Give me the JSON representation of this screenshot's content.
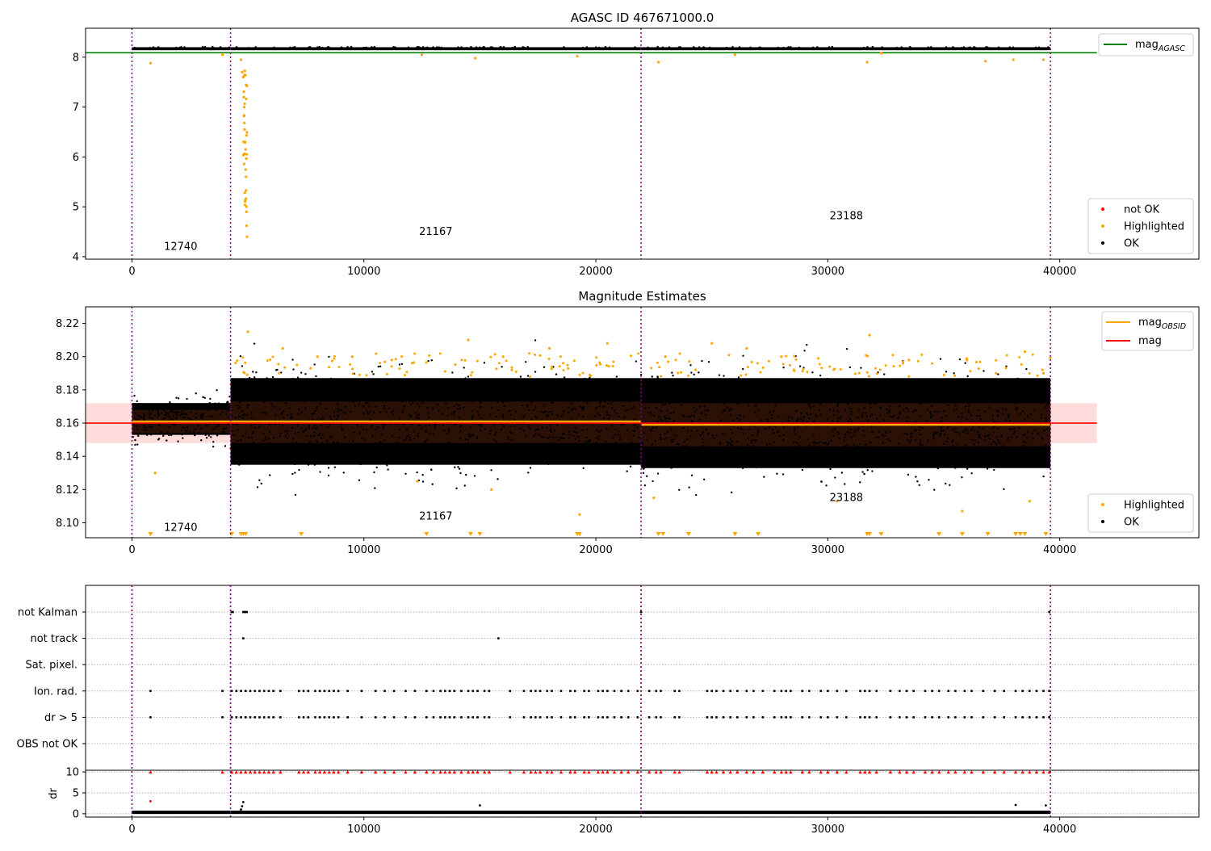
{
  "chart_data": [
    {
      "type": "scatter",
      "title": "AGASC ID 467671000.0",
      "xlim": [
        -2000,
        46000
      ],
      "ylim": [
        3.95,
        8.58
      ],
      "xticks": [
        "0",
        "10000",
        "20000",
        "30000",
        "40000"
      ],
      "yticks": [
        "4",
        "5",
        "6",
        "7",
        "8"
      ],
      "obs_boundaries": [
        0,
        4250,
        21950,
        39600
      ],
      "obsids": [
        {
          "label": "12740",
          "x": 2100,
          "y": 4.2
        },
        {
          "label": "21167",
          "x": 13100,
          "y": 4.5
        },
        {
          "label": "23188",
          "x": 30800,
          "y": 4.82
        }
      ],
      "reference_line": {
        "name": "mag$_{AGASC}$",
        "name_main": "mag",
        "name_sub": "AGASC",
        "y": 8.09,
        "x_end": 41600,
        "color": "#008000"
      },
      "ok_band": {
        "y_min": 8.14,
        "y_max": 8.2,
        "x": [
          0,
          39600
        ],
        "color": "#000000"
      },
      "highlighted": {
        "color": "#ffa500",
        "x": [
          800,
          3900,
          4700,
          4750,
          4800,
          4820,
          4840,
          4860,
          4880,
          4900,
          4920,
          4940,
          4960,
          12500,
          14800,
          19200,
          22700,
          26000,
          31700,
          32300,
          36800,
          38000,
          39300
        ],
        "y": [
          7.88,
          8.05,
          7.95,
          7.7,
          7.6,
          7.2,
          7.0,
          6.55,
          6.3,
          6.15,
          5.6,
          4.9,
          4.4,
          8.05,
          7.98,
          8.02,
          7.9,
          8.05,
          7.9,
          8.08,
          7.92,
          7.95,
          7.95
        ]
      },
      "legend_series": [
        {
          "label": "not OK",
          "color": "#ff0000"
        },
        {
          "label": "Highlighted",
          "color": "#ffa500"
        },
        {
          "label": "OK",
          "color": "#000000"
        }
      ]
    },
    {
      "type": "scatter",
      "title": "Magnitude Estimates",
      "xlim": [
        -2000,
        46000
      ],
      "ylim": [
        8.091,
        8.23
      ],
      "xticks": [
        "0",
        "10000",
        "20000",
        "30000",
        "40000"
      ],
      "yticks": [
        "8.10",
        "8.12",
        "8.14",
        "8.16",
        "8.18",
        "8.20",
        "8.22"
      ],
      "obs_boundaries": [
        0,
        4250,
        21950,
        39600
      ],
      "obsids": [
        {
          "label": "12740",
          "x": 2100,
          "y": 8.097
        },
        {
          "label": "21167",
          "x": 13100,
          "y": 8.104
        },
        {
          "label": "23188",
          "x": 30800,
          "y": 8.115
        }
      ],
      "segments": [
        {
          "x0": 0,
          "x1": 4250,
          "ok_min": 8.15,
          "ok_max": 8.175,
          "core_min": 8.154,
          "core_max": 8.168,
          "mag_obsid": 8.161
        },
        {
          "x0": 4250,
          "x1": 21950,
          "ok_min": 8.132,
          "ok_max": 8.19,
          "core_min": 8.148,
          "core_max": 8.173,
          "mag_obsid": 8.161
        },
        {
          "x0": 21950,
          "x1": 39600,
          "ok_min": 8.13,
          "ok_max": 8.19,
          "core_min": 8.146,
          "core_max": 8.172,
          "mag_obsid": 8.159
        }
      ],
      "mag_line": {
        "y": 8.16,
        "band": [
          8.148,
          8.172
        ],
        "x_end": 41600,
        "color": "#ff0000"
      },
      "highlighted": {
        "color": "#ffa500",
        "x": [
          5000,
          6500,
          8000,
          9500,
          11200,
          14500,
          16000,
          18000,
          20500,
          23000,
          25000,
          26500,
          28000,
          31800,
          33500,
          36000,
          38500,
          39300,
          1000,
          12300,
          15500,
          19300,
          22500,
          30400,
          35800,
          38700
        ],
        "y": [
          8.215,
          8.205,
          8.2,
          8.2,
          8.198,
          8.21,
          8.2,
          8.205,
          8.208,
          8.2,
          8.208,
          8.205,
          8.2,
          8.213,
          8.198,
          8.198,
          8.203,
          8.19,
          8.13,
          8.125,
          8.12,
          8.105,
          8.115,
          8.113,
          8.107,
          8.113
        ]
      },
      "below_range": {
        "color": "#ffa500",
        "x": [
          800,
          4300,
          4700,
          4800,
          4900,
          7300,
          12700,
          14600,
          15000,
          19200,
          19300,
          22700,
          22900,
          24000,
          26000,
          27000,
          31700,
          31800,
          32300,
          34800,
          35800,
          36900,
          38100,
          38300,
          38500,
          39400
        ]
      },
      "legend_lines": [
        {
          "label": "mag$_{OBSID}$",
          "label_main": "mag",
          "label_sub": "OBSID",
          "color": "#ffa500"
        },
        {
          "label": "mag",
          "label_main": "mag",
          "label_sub": "",
          "color": "#ff0000"
        }
      ],
      "legend_series": [
        {
          "label": "Highlighted",
          "color": "#ffa500"
        },
        {
          "label": "OK",
          "color": "#000000"
        }
      ]
    },
    {
      "type": "scatter",
      "title": "",
      "xlim": [
        -2000,
        46000
      ],
      "xticks": [
        "0",
        "10000",
        "20000",
        "30000",
        "40000"
      ],
      "obs_boundaries": [
        0,
        4250,
        21950,
        39600
      ],
      "flag_rows": [
        "not Kalman",
        "not track",
        "Sat. pixel.",
        "Ion. rad.",
        "dr > 5",
        "OBS not OK"
      ],
      "flags": {
        "not Kalman": [
          4300,
          4350,
          4800,
          4850,
          4900,
          4950,
          21950,
          39550
        ],
        "not track": [
          4800,
          15800
        ],
        "Ion. rad.": [
          800,
          3900,
          4300,
          4500,
          4700,
          4900,
          5100,
          5300,
          5500,
          5700,
          5900,
          6100,
          6400,
          7200,
          7400,
          7600,
          7900,
          8100,
          8300,
          8500,
          8700,
          8900,
          9300,
          9900,
          10500,
          10900,
          11300,
          11800,
          12200,
          12700,
          13000,
          13300,
          13500,
          13700,
          13900,
          14200,
          14500,
          14700,
          14900,
          15200,
          15400,
          16300,
          16900,
          17200,
          17400,
          17600,
          17900,
          18100,
          18500,
          18900,
          19100,
          19500,
          19700,
          20100,
          20300,
          20500,
          20800,
          21100,
          21400,
          21800,
          22300,
          22600,
          22800,
          23400,
          23600,
          24800,
          25000,
          25200,
          25500,
          25800,
          26100,
          26500,
          26800,
          27200,
          27700,
          28000,
          28200,
          28400,
          28900,
          29200,
          29700,
          30000,
          30400,
          30800,
          31400,
          31600,
          31800,
          32100,
          32700,
          33100,
          33400,
          33700,
          34200,
          34500,
          34800,
          35200,
          35500,
          35900,
          36200,
          36700,
          37200,
          37600,
          38100,
          38400,
          38700,
          39000,
          39300,
          39550
        ],
        "dr > 5": [
          800,
          3900,
          4300,
          4500,
          4700,
          4900,
          5100,
          5300,
          5500,
          5700,
          5900,
          6100,
          6400,
          7200,
          7400,
          7600,
          7900,
          8100,
          8300,
          8500,
          8700,
          8900,
          9300,
          9900,
          10500,
          10900,
          11300,
          11800,
          12200,
          12700,
          13000,
          13300,
          13500,
          13700,
          13900,
          14200,
          14500,
          14700,
          14900,
          15200,
          15400,
          16300,
          16900,
          17200,
          17400,
          17600,
          17900,
          18100,
          18500,
          18900,
          19100,
          19500,
          19700,
          20100,
          20300,
          20500,
          20800,
          21100,
          21400,
          21800,
          22300,
          22600,
          22800,
          23400,
          23600,
          24800,
          25000,
          25200,
          25500,
          25800,
          26100,
          26500,
          26800,
          27200,
          27700,
          28000,
          28200,
          28400,
          28900,
          29200,
          29700,
          30000,
          30400,
          30800,
          31400,
          31600,
          31800,
          32100,
          32700,
          33100,
          33400,
          33700,
          34200,
          34500,
          34800,
          35200,
          35500,
          35900,
          36200,
          36700,
          37200,
          37600,
          38100,
          38400,
          38700,
          39000,
          39300,
          39550
        ]
      },
      "dr_panel": {
        "ylabel": "dr",
        "yticks": [
          "0",
          "5",
          "10"
        ],
        "ylim": [
          -0.8,
          10.4
        ],
        "clip_level": 10,
        "clipped_color": "#ff0000",
        "dr_baseline": 0.25,
        "outliers": {
          "x": [
            800,
            4700,
            4750,
            4800,
            15000,
            38100,
            39400
          ],
          "y": [
            3.0,
            1.0,
            1.8,
            2.8,
            2.0,
            2.1,
            2.0
          ]
        }
      }
    }
  ]
}
